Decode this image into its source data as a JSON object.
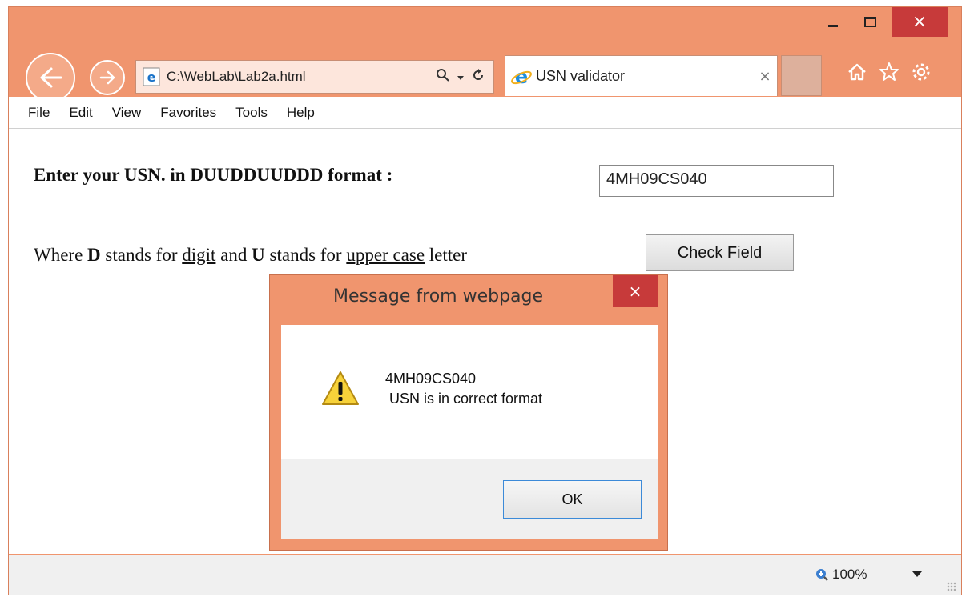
{
  "window": {
    "minimize_icon": "minimize-icon",
    "maximize_icon": "maximize-icon",
    "close_label": "×"
  },
  "address_bar": {
    "url": "C:\\WebLab\\Lab2a.html"
  },
  "tab": {
    "title": "USN validator",
    "close_label": "×"
  },
  "menu": [
    "File",
    "Edit",
    "View",
    "Favorites",
    "Tools",
    "Help"
  ],
  "page": {
    "prompt": "Enter your USN. in DUUDDUUDDD format :",
    "usn_value": "4MH09CS040",
    "hint_where": "Where ",
    "hint_D": "D",
    "hint_stands_for_1": " stands for ",
    "hint_digit": "digit",
    "hint_and": " and ",
    "hint_U": "U",
    "hint_stands_for_2": " stands for ",
    "hint_upper": "upper case",
    "hint_letter": " letter",
    "check_button": "Check Field"
  },
  "dialog": {
    "title": "Message from webpage",
    "close_label": "×",
    "message_line1": "4MH09CS040",
    "message_line2": " USN is in correct format",
    "ok_button": "OK"
  },
  "statusbar": {
    "zoom": "100%"
  },
  "colors": {
    "window_frame": "#f0956e",
    "close_red": "#c73a3a",
    "ok_border": "#3c8ad8"
  }
}
